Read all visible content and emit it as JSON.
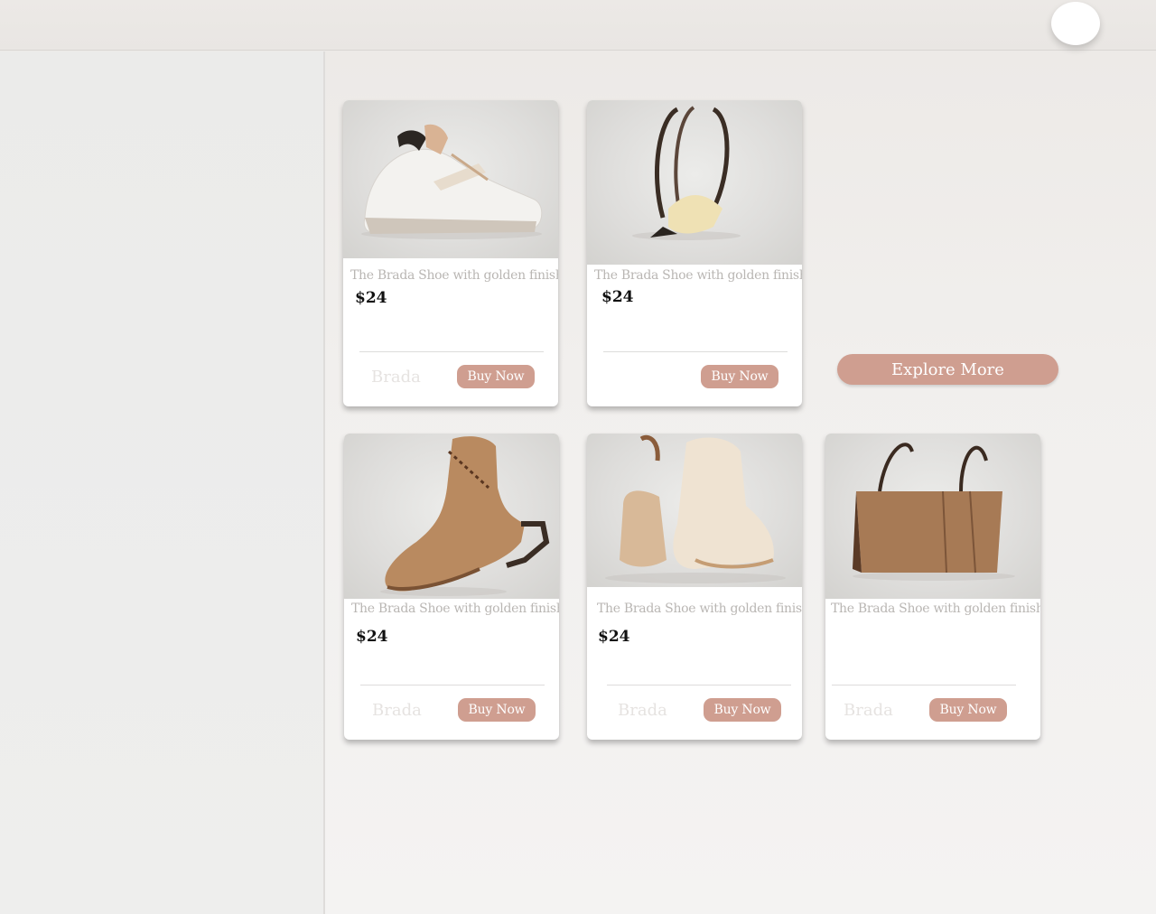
{
  "header": {
    "avatar_label": ""
  },
  "products": [
    {
      "title": "The Brada Shoe with golden finish",
      "price": "$24",
      "brand": "Brada",
      "button": "Buy Now",
      "image": "white-sneaker"
    },
    {
      "title": "The Brada Shoe with golden finish",
      "price": "$24",
      "brand": "",
      "button": "Buy Now",
      "image": "golden-strap-sandal"
    },
    {
      "title": "The Brada Shoe with golden finish",
      "price": "$24",
      "brand": "Brada",
      "button": "Buy Now",
      "image": "tan-lace-up-boot"
    },
    {
      "title": "The Brada Shoe with golden finish",
      "price": "$24",
      "brand": "Brada",
      "button": "Buy Now",
      "image": "cream-boots-pair"
    },
    {
      "title": "The Brada Shoe with golden finish",
      "price": "",
      "brand": "Brada",
      "button": "Buy Now",
      "image": "brown-tote-bag"
    }
  ],
  "explore": {
    "label": "Explore More"
  },
  "colors": {
    "accent": "#cf9e90",
    "background": "#f1efed",
    "card": "#ffffff"
  }
}
